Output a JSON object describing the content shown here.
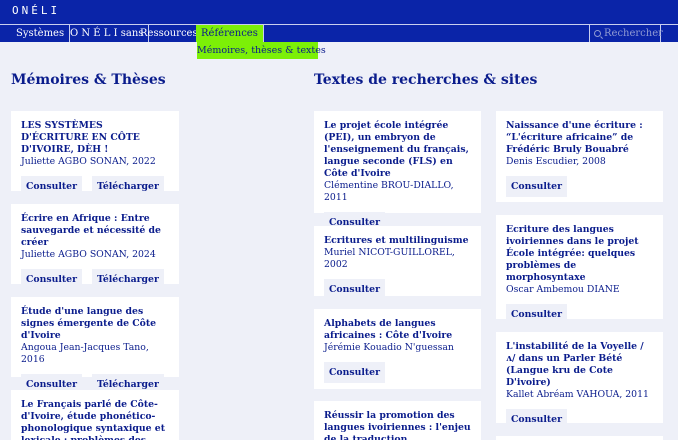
{
  "brand": "ONÉLI",
  "nav": {
    "items": [
      "Systèmes",
      "O N É L I sans",
      "Ressources",
      "Références"
    ],
    "search_placeholder": "Rechercher"
  },
  "submenu": {
    "label": "Mémoires, thèses & textes"
  },
  "memoires": {
    "title": "Mémoires & Thèses",
    "cards": [
      {
        "title": "LES SYSTÈMES D'ÉCRITURE EN CÔTE D'IVOIRE, DÈH !",
        "author": "Juliette AGBO SONAN, 2022",
        "consult": "Consulter",
        "download": "Télécharger"
      },
      {
        "title": "Écrire en Afrique : Entre sauvegarde et nécessité de créer",
        "author": "Juliette AGBO SONAN, 2024",
        "consult": "Consulter",
        "download": "Télécharger"
      },
      {
        "title": "Étude d'une langue des signes émergente de Côte d'Ivoire",
        "author": "Angoua Jean-Jacques Tano, 2016",
        "consult": "Consulter",
        "download": "Télécharger"
      },
      {
        "title": "Le Français parlé de Côte-d'Ivoire, étude phonético-phonologique syntaxique et lexicale : problèmes des",
        "author": "",
        "consult": "",
        "download": ""
      }
    ]
  },
  "textes": {
    "title": "Textes de recherches & sites",
    "col1": [
      {
        "title": "Le projet école intégrée (PEI), un embryon  de l'enseignement du français, langue seconde (FLS) en Côte d'Ivoire",
        "author": "Clémentine BROU-DIALLO, 2011",
        "consult": "Consulter"
      },
      {
        "title": "Ecritures et multilinguisme",
        "author": "Muriel NICOT-GUILLOREL, 2002",
        "consult": "Consulter"
      },
      {
        "title": "Alphabets de langues africaines : Côte d'Ivoire",
        "author": "Jérémie Kouadio N'guessan",
        "consult": "Consulter"
      },
      {
        "title": "Réussir la promotion des langues ivoiriennes : l'enjeu de la traduction",
        "author": "",
        "consult": ""
      }
    ],
    "col2": [
      {
        "title": "Naissance d'une écriture : “L'écriture africaine” de Frédéric Bruly Bouabré",
        "author": "Denis Escudier, 2008",
        "consult": "Consulter"
      },
      {
        "title": "Ecriture des langues ivoiriennes dans le projet École intégrée: quelques problèmes de morphosyntaxe",
        "author": "Oscar Ambemou DIANE",
        "consult": "Consulter"
      },
      {
        "title": "L'instabilité de la Voyelle /ʌ/ dans un Parler Bété (Langue kru de Cote D'ivoire)",
        "author": "Kallet Abréam VAHOUA, 2011",
        "consult": "Consulter"
      },
      {
        "title": "",
        "author": "",
        "consult": ""
      }
    ]
  },
  "colors": {
    "primary": "#0a24a8",
    "accent": "#7cf007",
    "background": "#eef0f8",
    "text": "#0a1c8c"
  }
}
